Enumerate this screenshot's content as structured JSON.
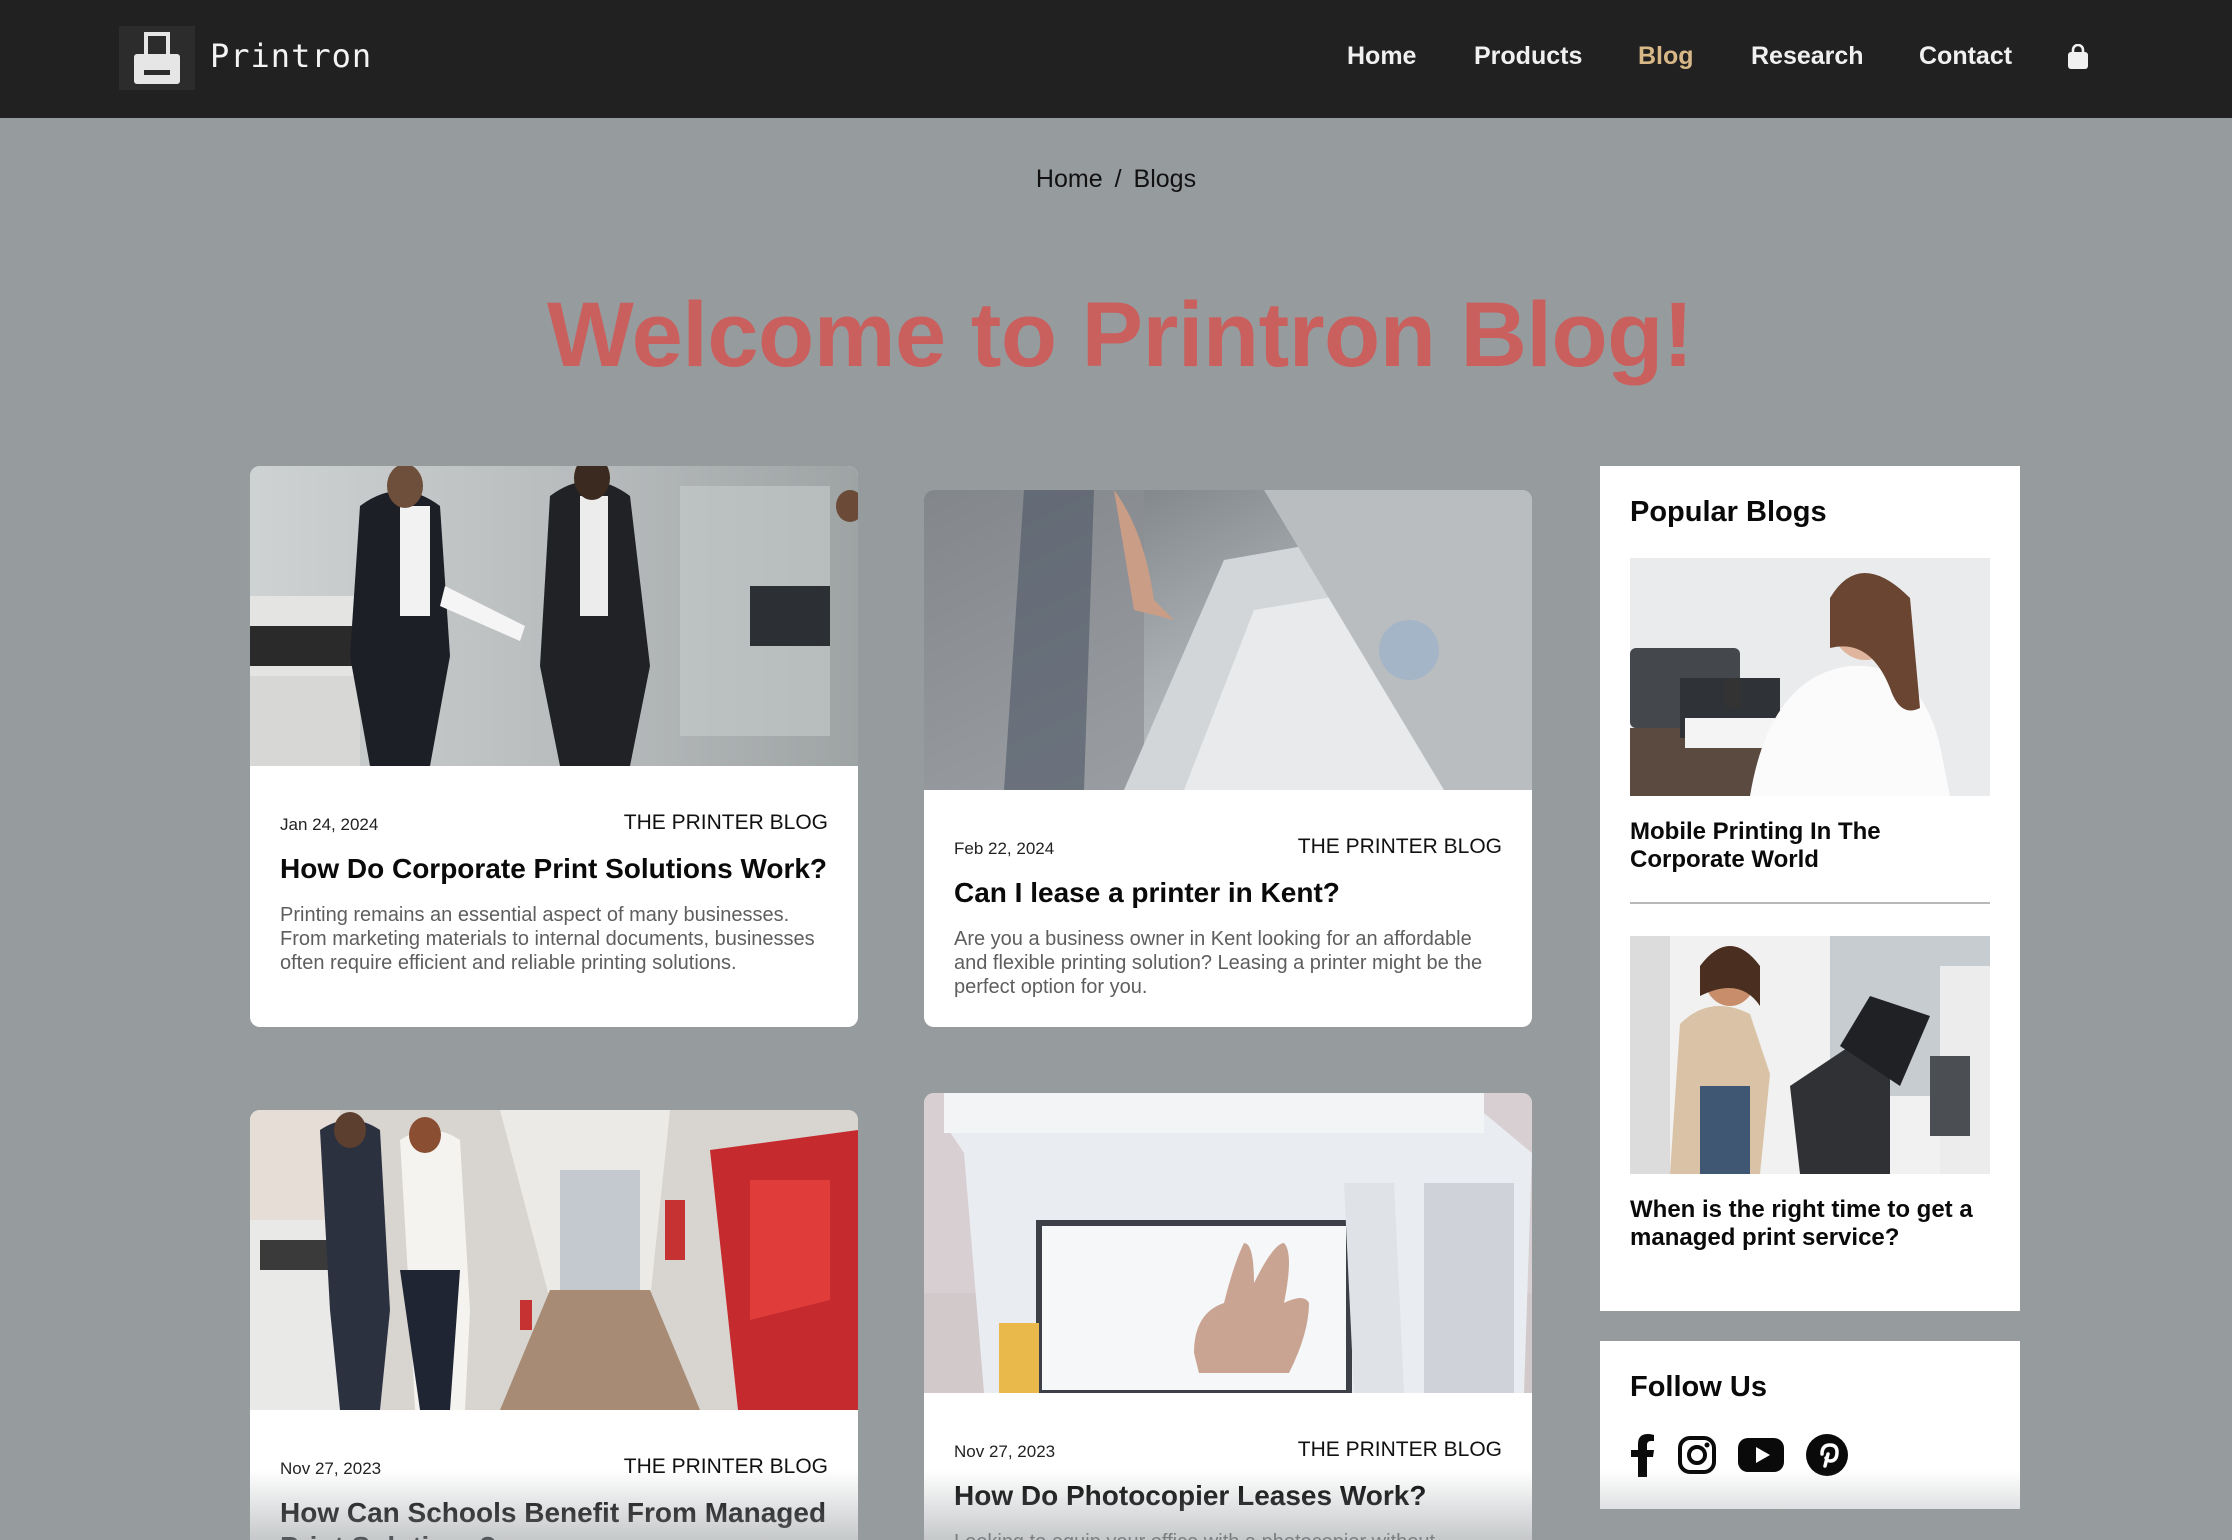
{
  "header": {
    "brand": "Printron",
    "nav": [
      "Home",
      "Products",
      "Blog",
      "Research",
      "Contact"
    ],
    "active_nav": "Blog",
    "cart_icon": "shopping-bag-icon",
    "logo_icon": "printer-icon"
  },
  "breadcrumb": {
    "home": "Home",
    "separator": "/",
    "current": "Blogs"
  },
  "page_title": "Welcome to Printron Blog!",
  "posts": [
    {
      "date": "Jan 24, 2024",
      "category": "THE PRINTER BLOG",
      "title": "How Do Corporate Print Solutions Work?",
      "excerpt": "Printing remains an essential aspect of many businesses. From marketing materials to internal documents, businesses often require efficient and reliable printing solutions."
    },
    {
      "date": "Feb 22, 2024",
      "category": "THE PRINTER BLOG",
      "title": "Can I lease a printer in Kent?",
      "excerpt": "Are you a business owner in Kent looking for an affordable and flexible printing solution? Leasing a printer might be the perfect option for you."
    },
    {
      "date": "Nov 27, 2023",
      "category": "THE PRINTER BLOG",
      "title": "How Can Schools Benefit From Managed Print Solutions?",
      "excerpt": ""
    },
    {
      "date": "Nov 27, 2023",
      "category": "THE PRINTER BLOG",
      "title": "How Do Photocopier Leases Work?",
      "excerpt": "Looking to equip your office with a photocopier without"
    }
  ],
  "sidebar": {
    "popular_title": "Popular Blogs",
    "popular": [
      {
        "title": "Mobile Printing In The Corporate World"
      },
      {
        "title": "When is the right time to get a managed print service?"
      }
    ],
    "follow_title": "Follow Us",
    "social_icons": [
      "facebook-icon",
      "instagram-icon",
      "youtube-icon",
      "pinterest-icon"
    ]
  },
  "colors": {
    "header_bg": "#212121",
    "page_bg": "#969b9e",
    "title_red": "#c9605e",
    "active_nav": "#d9b887"
  }
}
